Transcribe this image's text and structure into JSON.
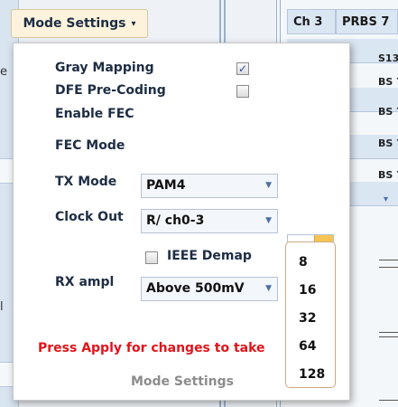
{
  "top_button": {
    "label": "Mode Settings",
    "caret": "▾"
  },
  "background": {
    "channel_header": "Ch 3",
    "prbs_header": "PRBS 7",
    "row_fragments": [
      "S13",
      "BS 7",
      "BS 7",
      "BS 7",
      "BS 7",
      "▾"
    ],
    "left_fragments": [
      "e",
      "l",
      "("
    ]
  },
  "panel": {
    "gray_mapping": {
      "label": "Gray Mapping",
      "checked": true,
      "mark": "✓"
    },
    "dfe_precoding": {
      "label": "DFE Pre-Coding",
      "checked": false
    },
    "enable_fec": {
      "label": "Enable FEC"
    },
    "fec_mode": {
      "label": "FEC Mode"
    },
    "tx_mode": {
      "label": "TX Mode",
      "value": "PAM4"
    },
    "clock_out": {
      "label": "Clock Out",
      "value": "R/ ch0-3"
    },
    "ieee_demap": {
      "label": "IEEE Demap",
      "checked": false
    },
    "rx_ampl": {
      "label": "RX ampl",
      "value": "Above 500mV"
    },
    "warning": "Press Apply for changes to take",
    "footer": "Mode Settings"
  },
  "fec_dropdown": {
    "value": "",
    "options": [
      "8",
      "16",
      "32",
      "64",
      "128"
    ]
  },
  "colors": {
    "button_bg": "#fdf3dc",
    "warning": "#e0141a",
    "dropdown_button": "#f6c453"
  }
}
